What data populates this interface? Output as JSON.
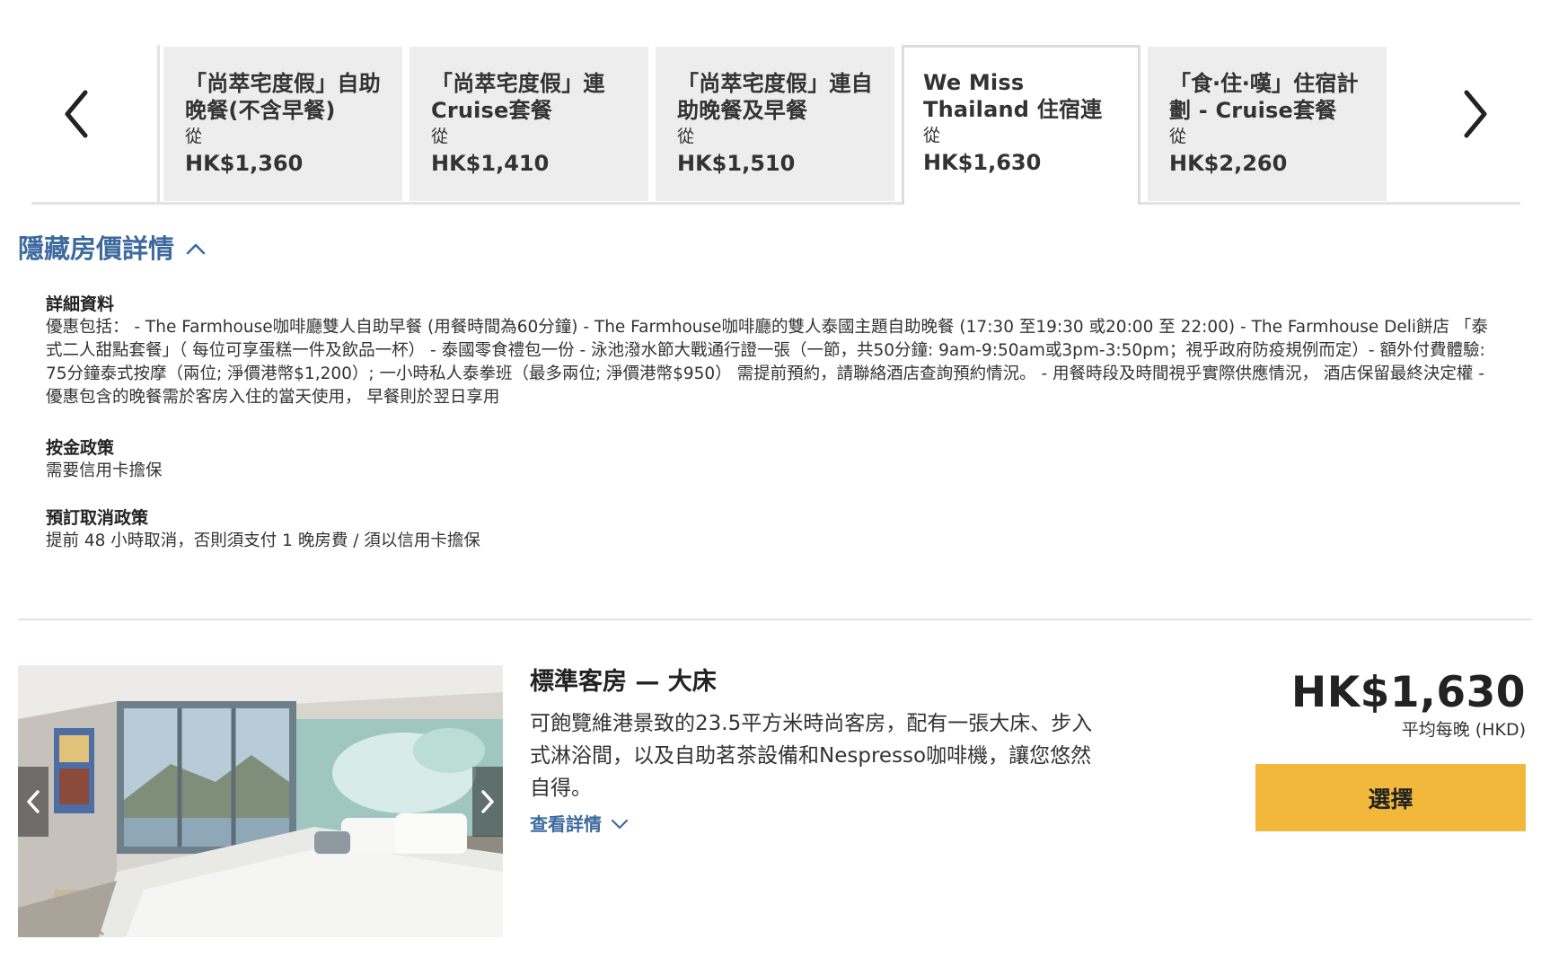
{
  "colors": {
    "accent_link": "#3d6a9e",
    "tab_inactive_bg": "#ededed",
    "select_button_bg": "#f2b83b"
  },
  "carousel": {
    "prev_icon": "chevron-left-icon",
    "next_icon": "chevron-right-icon",
    "tabs": [
      {
        "title": "「尚萃宅度假」自助晚餐(不含早餐)",
        "from": "從",
        "price": "HK$1,360",
        "selected": false
      },
      {
        "title": "「尚萃宅度假」連Cruise套餐",
        "from": "從",
        "price": "HK$1,410",
        "selected": false
      },
      {
        "title": "「尚萃宅度假」連自助晚餐及早餐",
        "from": "從",
        "price": "HK$1,510",
        "selected": false
      },
      {
        "title": "We Miss Thailand 住宿連自助晚餐",
        "from": "從",
        "price": "HK$1,630",
        "selected": true
      },
      {
        "title": "「食‧住‧嘆」住宿計劃 - Cruise套餐",
        "from": "從",
        "price": "HK$2,260",
        "selected": false
      }
    ]
  },
  "details_toggle": {
    "label": "隱藏房價詳情",
    "icon": "chevron-up-icon"
  },
  "details": {
    "info_heading": "詳細資料",
    "info_body": "優惠包括： - The Farmhouse咖啡廳雙人自助早餐 (用餐時間為60分鐘) - The Farmhouse咖啡廳的雙人泰國主題自助晚餐 (17:30 至19:30 或20:00 至 22:00) - The Farmhouse Deli餅店 「泰式二人甜點套餐」（ 每位可享蛋糕一件及飲品一杯） - 泰國零食禮包一份 - 泳池潑水節大戰通行證一張（一節，共50分鐘: 9am-9:50am或3pm-3:50pm；視乎政府防疫規例而定）- 額外付費體驗: 75分鐘泰式按摩（兩位; 淨價港幣$1,200）; 一小時私人泰拳班（最多兩位; 淨價港幣$950） 需提前預約，請聯絡酒店查詢預約情況。 - 用餐時段及時間視乎實際供應情況， 酒店保留最終決定權 - 優惠包含的晚餐需於客房入住的當天使用， 早餐則於翌日享用",
    "deposit_heading": "按金政策",
    "deposit_body": "需要信用卡擔保",
    "cancel_heading": "預訂取消政策",
    "cancel_body": "提前 48 小時取消，否則須支付 1 晚房費 / 須以信用卡擔保"
  },
  "room": {
    "name": "標準客房 — 大床",
    "description": "可飽覽維港景致的23.5平方米時尚客房，配有一張大床、步入式淋浴間，以及自助茗茶設備和Nespresso咖啡機，讓您悠然自得。",
    "more_label": "查看詳情",
    "more_icon": "chevron-down-icon",
    "price": "HK$1,630",
    "price_note": "平均每晚 (HKD)",
    "select_label": "選擇",
    "image_prev_icon": "chevron-left-icon",
    "image_next_icon": "chevron-right-icon"
  }
}
